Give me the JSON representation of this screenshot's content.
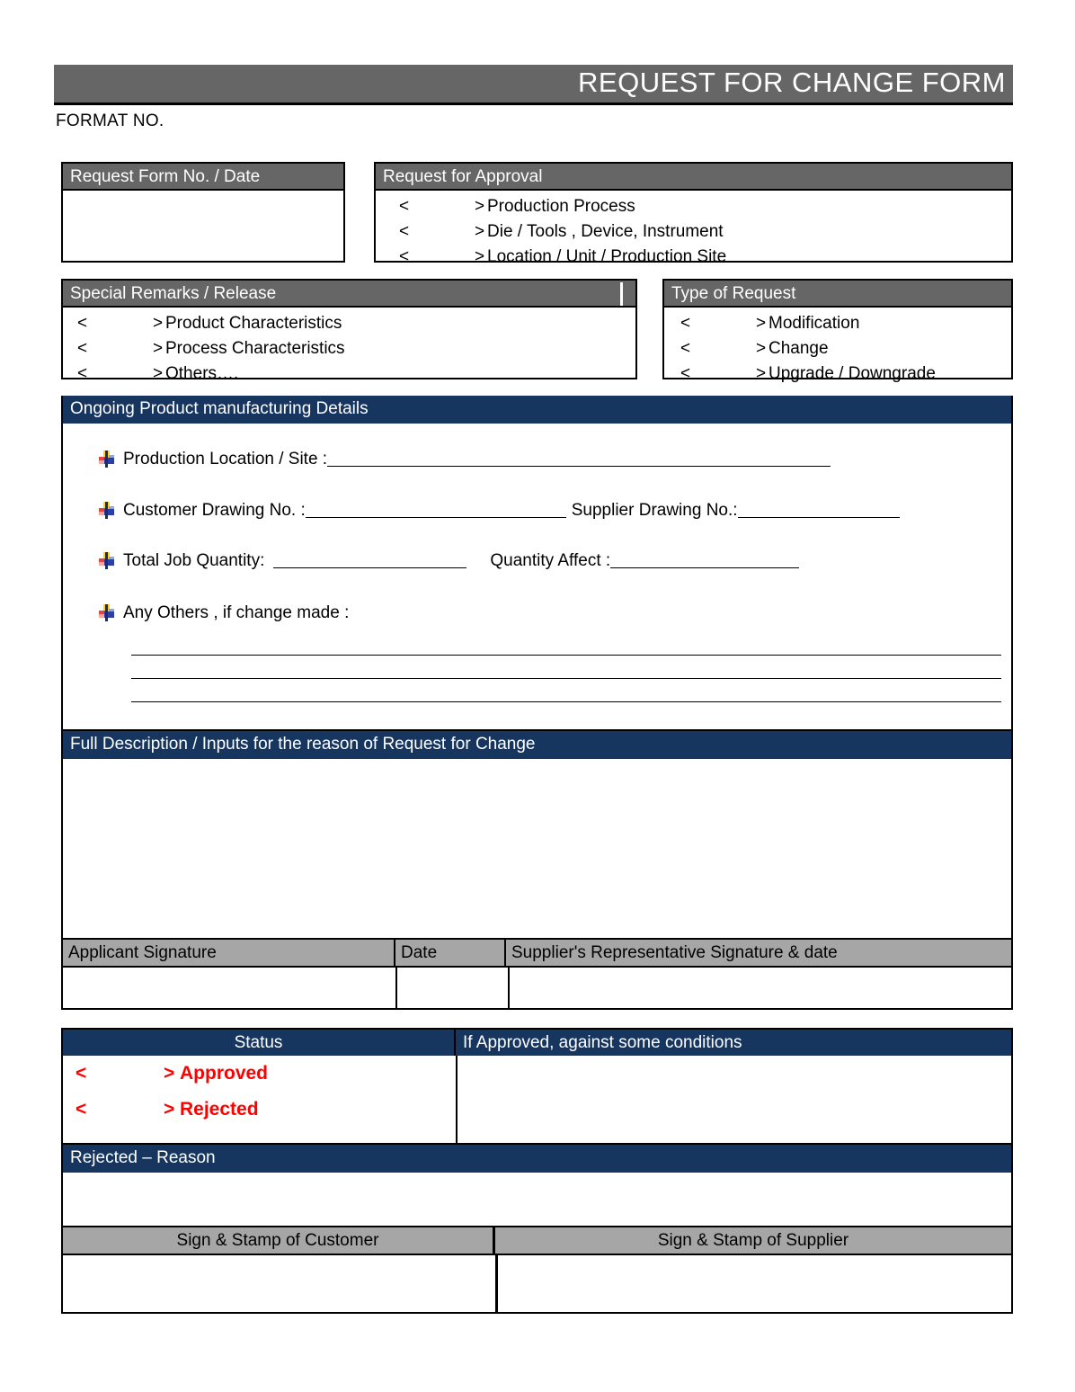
{
  "document": {
    "title": "REQUEST FOR CHANGE FORM",
    "format_no_label": "FORMAT NO."
  },
  "colors": {
    "header_gray": "#666666",
    "header_navy": "#16355F",
    "header_light_gray": "#A6A6A6",
    "status_red": "#FF0000",
    "border": "#000000"
  },
  "request_form_box": {
    "header": "Request Form No. / Date",
    "value": ""
  },
  "request_for_approval": {
    "header": "Request for Approval",
    "options": [
      {
        "left_bracket": "<",
        "right_bracket": ">",
        "label": "Production Process"
      },
      {
        "left_bracket": "<",
        "right_bracket": ">",
        "label": "Die / Tools , Device, Instrument"
      },
      {
        "left_bracket": "<",
        "right_bracket": ">",
        "label": "Location / Unit / Production Site"
      }
    ]
  },
  "special_remarks": {
    "header": "Special Remarks / Release",
    "options": [
      {
        "left_bracket": "<",
        "right_bracket": ">",
        "label": "Product Characteristics"
      },
      {
        "left_bracket": "<",
        "right_bracket": ">",
        "label": "Process Characteristics"
      },
      {
        "left_bracket": "<",
        "right_bracket": ">",
        "label": "Others…."
      }
    ]
  },
  "type_of_request": {
    "header": "Type of Request",
    "options": [
      {
        "left_bracket": "<",
        "right_bracket": ">",
        "label": "Modification"
      },
      {
        "left_bracket": "<",
        "right_bracket": ">",
        "label": "Change"
      },
      {
        "left_bracket": "<",
        "right_bracket": ">",
        "label": "Upgrade / Downgrade"
      }
    ]
  },
  "ongoing_details": {
    "header": "Ongoing Product manufacturing Details",
    "fields": {
      "production_location": "Production Location / Site :",
      "customer_drawing": "Customer Drawing No. :",
      "supplier_drawing": "Supplier Drawing No.:",
      "total_job_quantity": "Total Job Quantity:",
      "quantity_affect": "Quantity Affect :",
      "any_others": "Any Others ,  if change made :"
    },
    "values": {
      "production_location": "",
      "customer_drawing": "",
      "supplier_drawing": "",
      "total_job_quantity": "",
      "quantity_affect": "",
      "any_others_line1": "",
      "any_others_line2": "",
      "any_others_line3": ""
    }
  },
  "full_description": {
    "header": "Full Description / Inputs for the reason of Request for Change",
    "value": ""
  },
  "signature_row": {
    "applicant_signature": "Applicant Signature",
    "date": "Date",
    "supplier_representative": "Supplier's Representative Signature & date",
    "values": {
      "applicant_signature": "",
      "date": "",
      "supplier_representative": ""
    }
  },
  "status_section": {
    "status_header": "Status",
    "conditions_header": "If Approved,  against some conditions",
    "options": [
      {
        "left_bracket": "<",
        "right_bracket": ">",
        "label": "Approved"
      },
      {
        "left_bracket": "<",
        "right_bracket": ">",
        "label": "Rejected"
      }
    ],
    "conditions_value": ""
  },
  "rejected_reason": {
    "header": "Rejected – Reason",
    "value": ""
  },
  "stamp_row": {
    "customer": "Sign & Stamp of Customer",
    "supplier": "Sign & Stamp of Supplier",
    "values": {
      "customer": "",
      "supplier": ""
    }
  }
}
